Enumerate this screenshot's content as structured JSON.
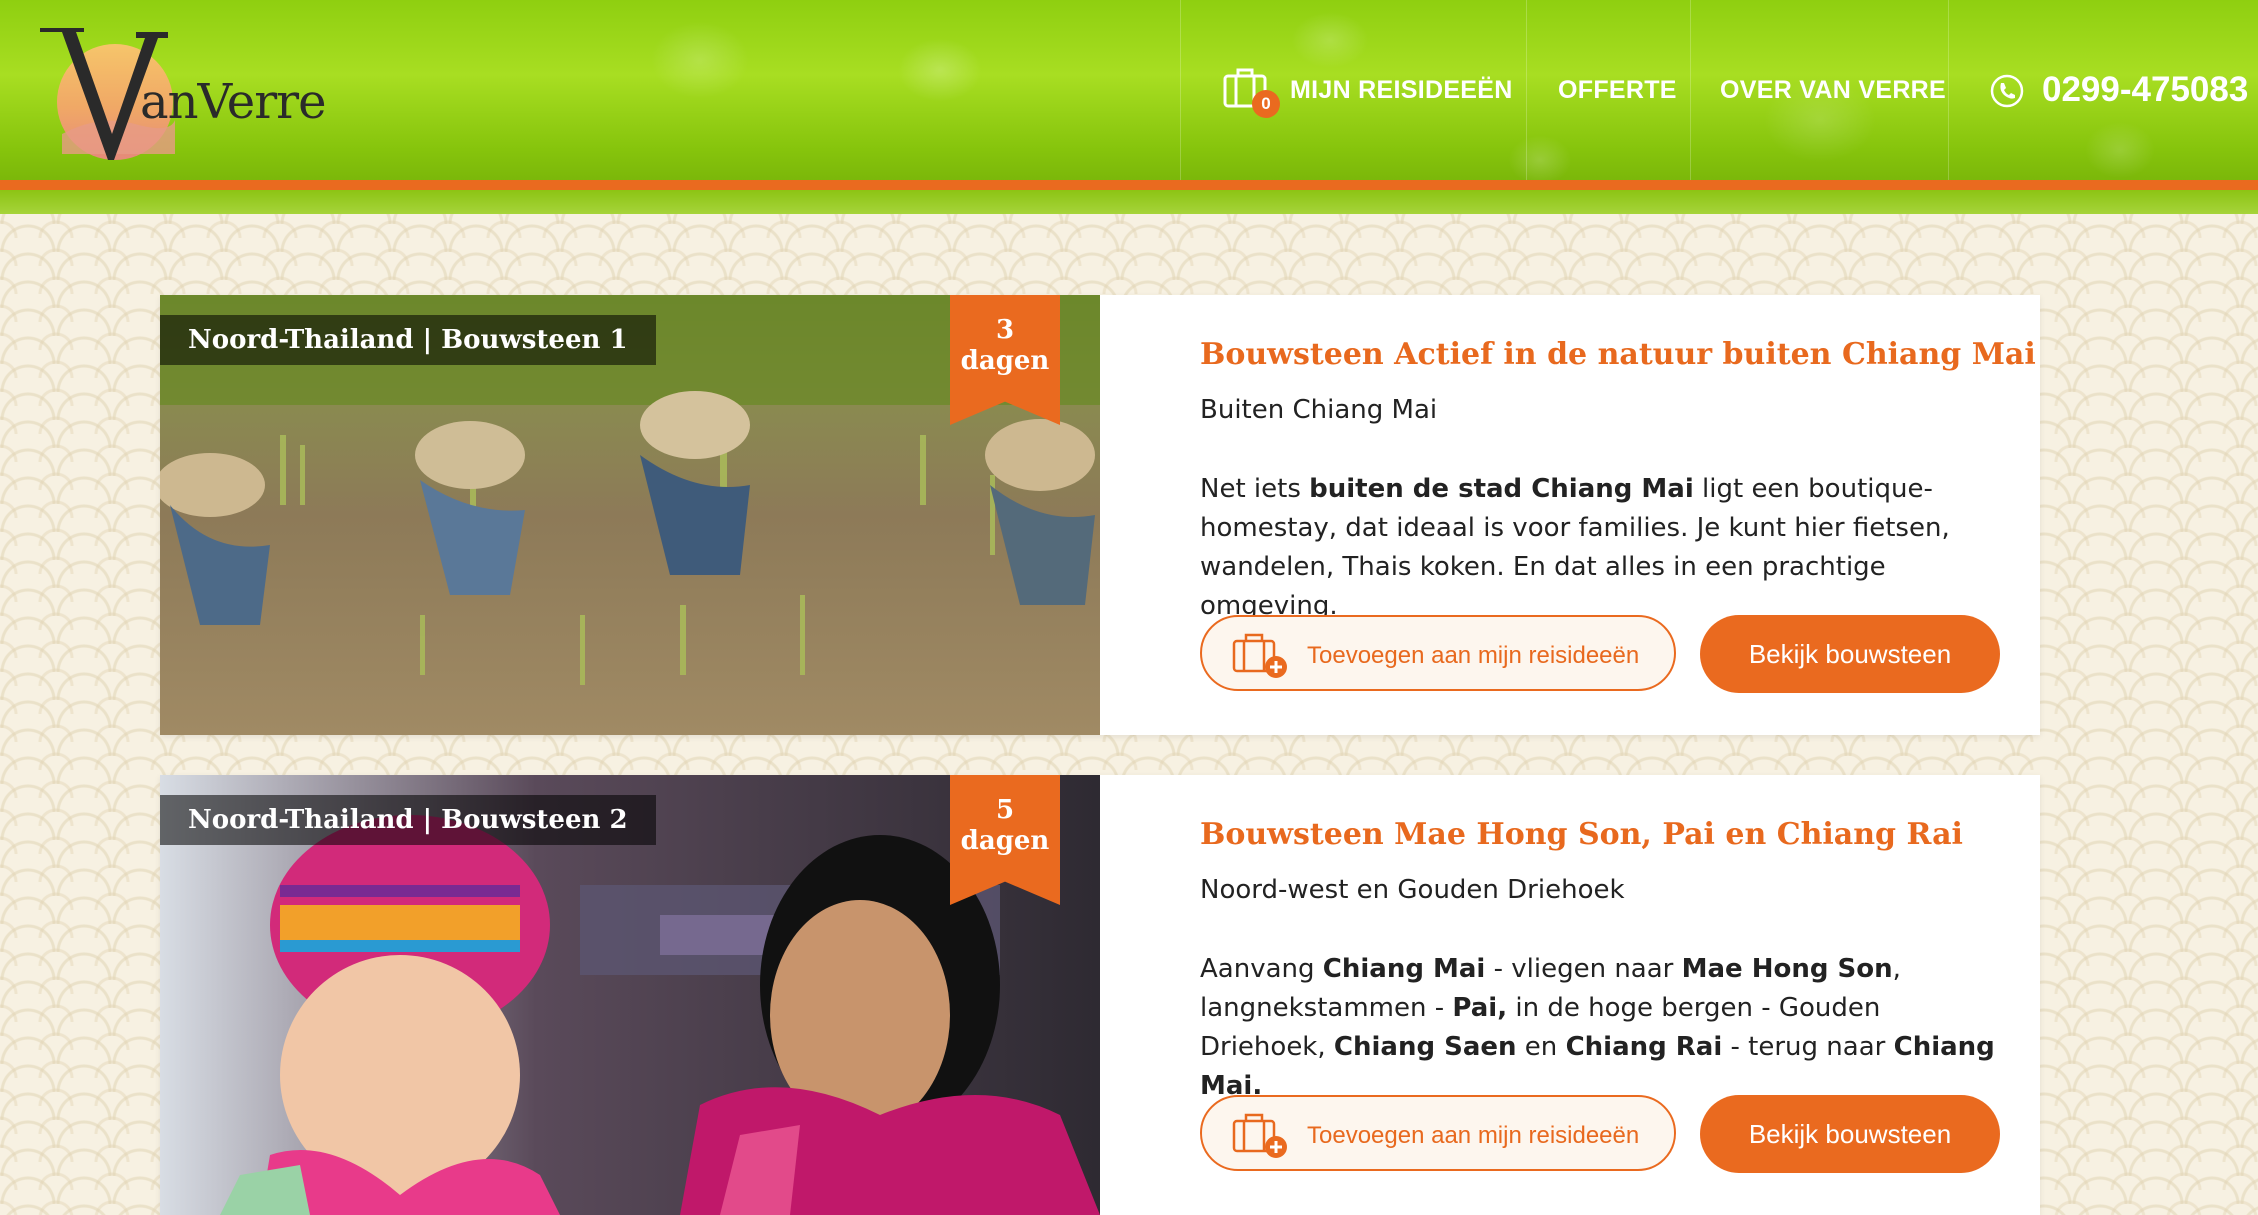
{
  "brand": {
    "logo_text": "anVerre",
    "logo_initial": "V"
  },
  "nav": {
    "cart_count": "0",
    "items": [
      "MIJN REISIDEEËN",
      "OFFERTE",
      "OVER VAN VERRE"
    ],
    "phone": "0299-475083"
  },
  "cards": [
    {
      "tag": "Noord-Thailand | Bouwsteen 1",
      "days_number": "3",
      "days_label": "dagen",
      "title": "Bouwsteen Actief in de natuur buiten Chiang Mai",
      "subtitle": "Buiten Chiang Mai",
      "description": [
        {
          "text": "Net iets ",
          "bold": false
        },
        {
          "text": "buiten de stad Chiang Mai",
          "bold": true
        },
        {
          "text": " ligt een boutique-homestay, dat ideaal is voor families. Je kunt hier fietsen, wandelen, Thais koken. En dat alles in een prachtige omgeving.",
          "bold": false
        }
      ],
      "add_label": "Toevoegen aan mijn reisideeën",
      "view_label": "Bekijk bouwsteen",
      "image": "rice-planting-photo"
    },
    {
      "tag": "Noord-Thailand | Bouwsteen 2",
      "days_number": "5",
      "days_label": "dagen",
      "title": "Bouwsteen Mae Hong Son, Pai en Chiang Rai",
      "subtitle": "Noord-west en Gouden Driehoek",
      "description": [
        {
          "text": "Aanvang ",
          "bold": false
        },
        {
          "text": "Chiang Mai",
          "bold": true
        },
        {
          "text": " - vliegen naar ",
          "bold": false
        },
        {
          "text": "Mae Hong Son",
          "bold": true
        },
        {
          "text": ", langnekstammen - ",
          "bold": false
        },
        {
          "text": "Pai,",
          "bold": true
        },
        {
          "text": " in de hoge bergen - Gouden Driehoek, ",
          "bold": false
        },
        {
          "text": "Chiang Saen",
          "bold": true
        },
        {
          "text": " en ",
          "bold": false
        },
        {
          "text": "Chiang Rai",
          "bold": true
        },
        {
          "text": " - terug naar ",
          "bold": false
        },
        {
          "text": "Chiang Mai.",
          "bold": true
        }
      ],
      "add_label": "Toevoegen aan mijn reisideeën",
      "view_label": "Bekijk bouwsteen",
      "image": "mother-and-child-photo"
    }
  ],
  "colors": {
    "accent": "#ea6a1f",
    "header_green": "#8fcf10"
  }
}
